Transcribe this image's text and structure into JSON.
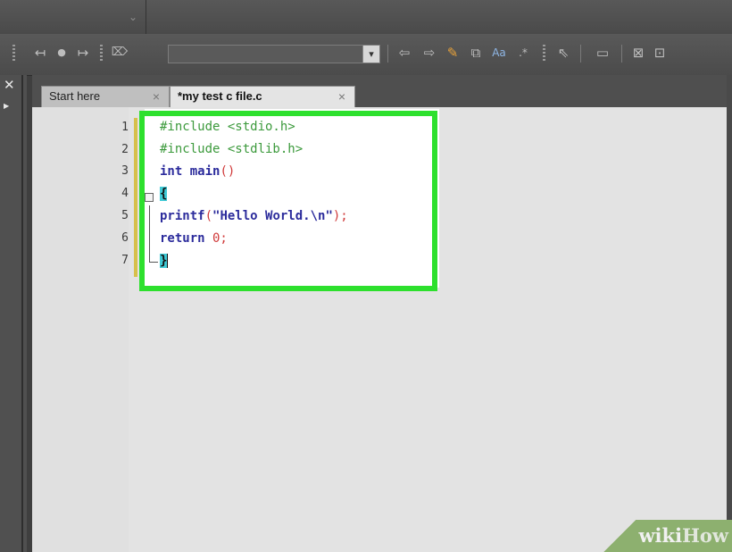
{
  "tabs": [
    {
      "label": "Start here"
    },
    {
      "label": "*my test c file.c"
    }
  ],
  "tab_close_glyph": "×",
  "line_numbers": [
    "1",
    "2",
    "3",
    "4",
    "5",
    "6",
    "7"
  ],
  "code": {
    "line1": "#include <stdio.h>",
    "line2": "#include <stdlib.h>",
    "line3_kw": "int",
    "line3_fn": " main",
    "line3_paren": "()",
    "line4": "{",
    "line5_fn": "printf",
    "line5_open": "(",
    "line5_str": "\"Hello World.\\n\"",
    "line5_close": ");",
    "line6_kw": "return",
    "line6_num": " 0;",
    "line7": "}"
  },
  "watermark": {
    "part1": "wiki",
    "part2": "How"
  },
  "colors": {
    "highlight": "#2de02d",
    "preprocessor": "#3c9a3c",
    "keyword": "#2c2c9c",
    "brace_match": "#3fcad6"
  }
}
